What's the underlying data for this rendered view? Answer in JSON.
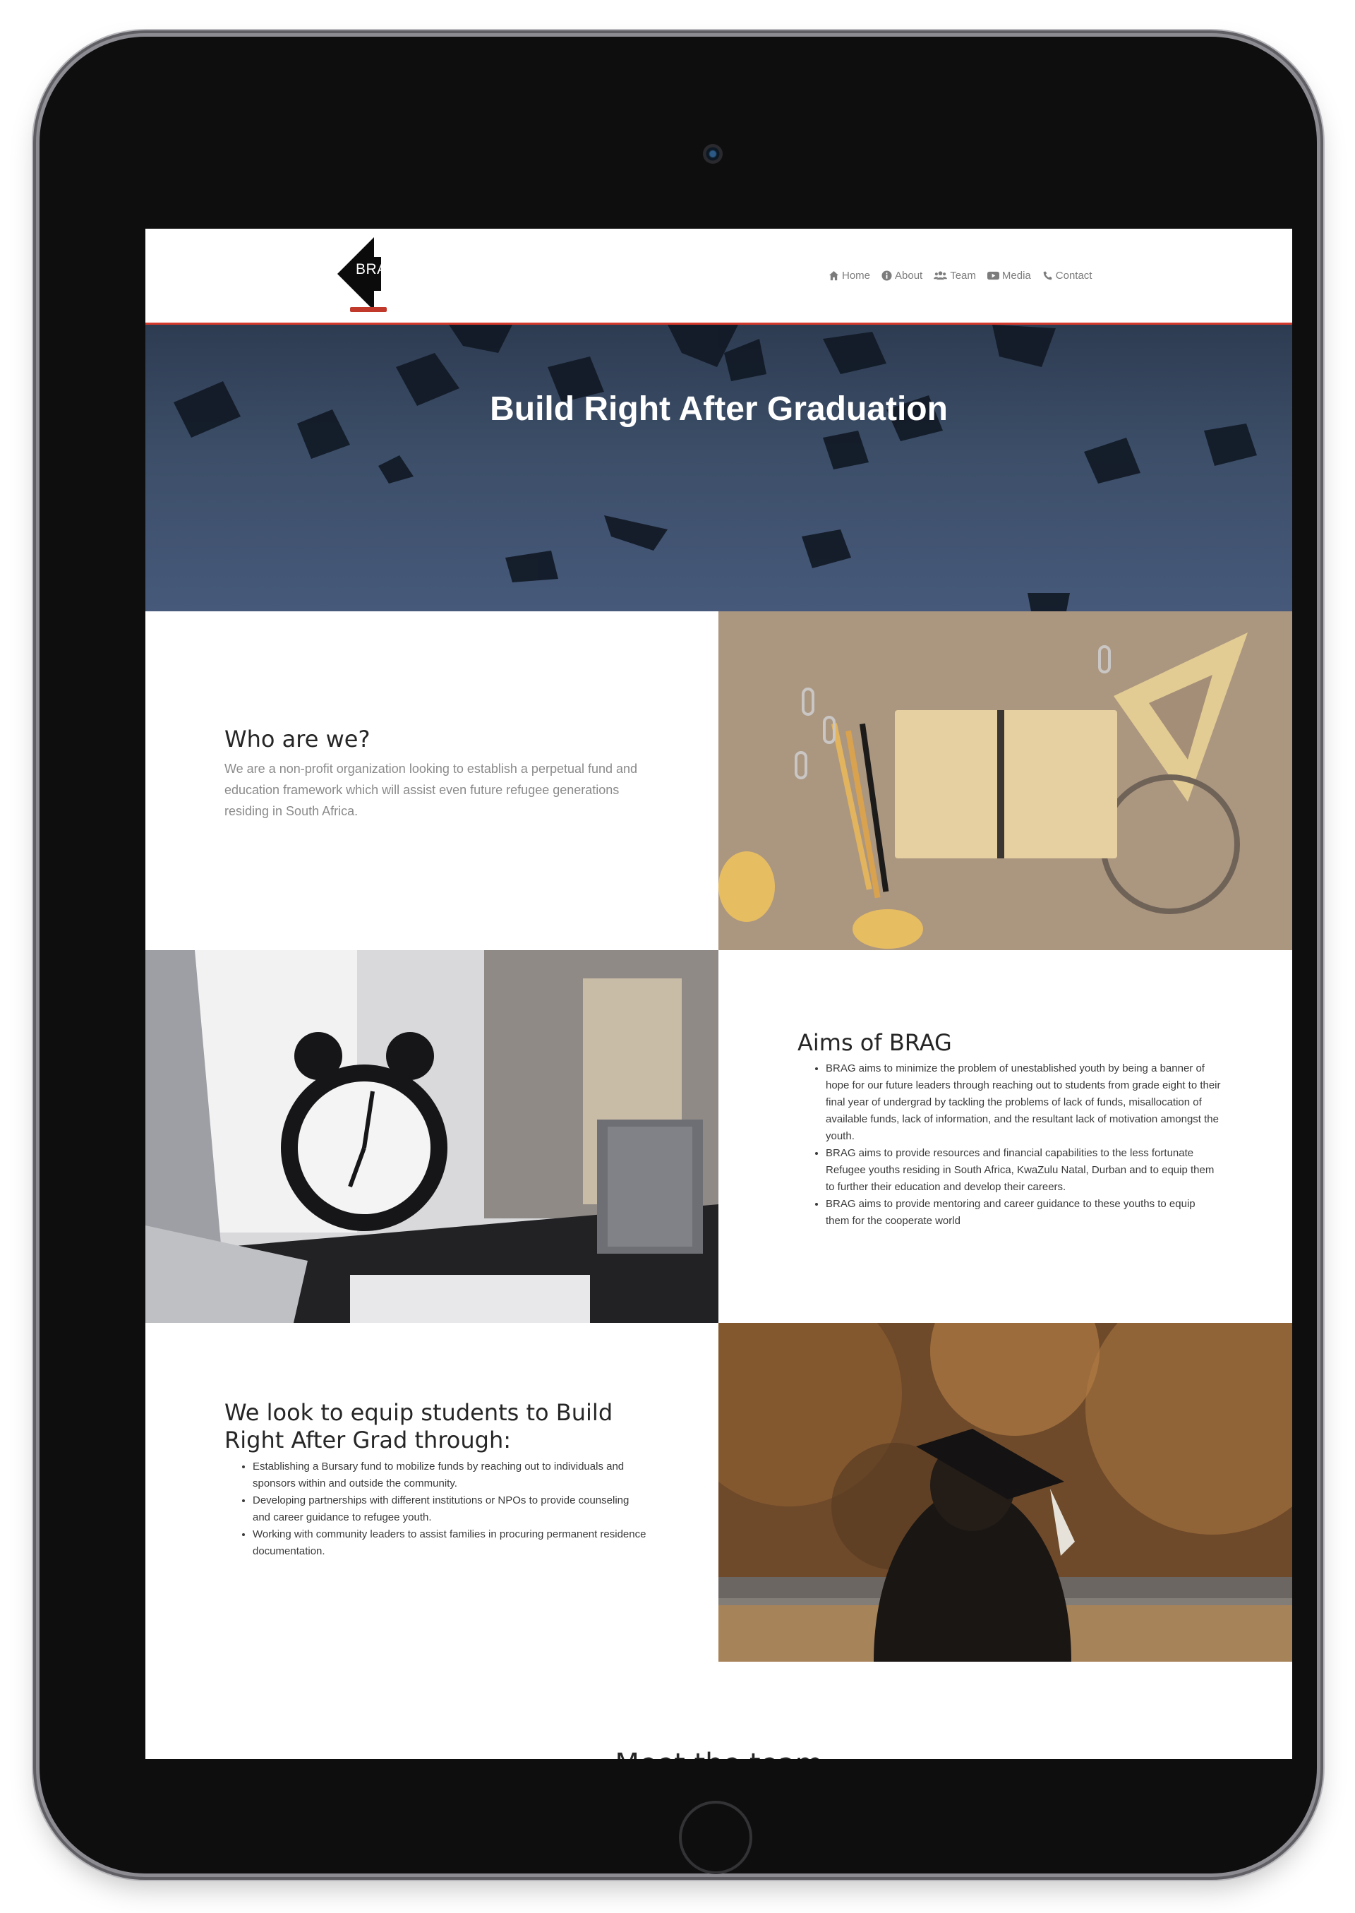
{
  "nav": {
    "logo_text": "BRAG",
    "items": [
      {
        "label": "Home",
        "icon": "home-icon"
      },
      {
        "label": "About",
        "icon": "info-icon"
      },
      {
        "label": "Team",
        "icon": "users-icon"
      },
      {
        "label": "Media",
        "icon": "youtube-icon"
      },
      {
        "label": "Contact",
        "icon": "phone-icon"
      }
    ]
  },
  "hero": {
    "title": "Build Right After Graduation"
  },
  "about": {
    "title": "Who are we?",
    "text": "We are a non-profit organization looking to establish a perpetual fund and education framework which will assist even future refugee generations residing in South Africa."
  },
  "aims": {
    "title": "Aims of BRAG",
    "items": [
      "BRAG aims to minimize the problem of unestablished youth by being a banner of hope for our future leaders through reaching out to students from grade eight to their final year of undergrad by tackling the problems of lack of funds, misallocation of available funds, lack of information, and the resultant lack of motivation amongst the youth.",
      "BRAG aims to provide resources and financial capabilities to the less fortunate Refugee youths residing in South Africa, KwaZulu Natal, Durban and to equip them to further their education and develop their careers.",
      "BRAG aims to provide mentoring and career guidance to these youths to equip them for the cooperate world"
    ]
  },
  "equip": {
    "title": "We look to equip students to Build Right After Grad through:",
    "items": [
      "Establishing a Bursary fund to mobilize funds by reaching out to individuals and sponsors within and outside the community.",
      "Developing partnerships with different institutions or NPOs to provide counseling and career guidance to refugee youth.",
      "Working with community leaders to assist families in procuring permanent residence documentation."
    ]
  },
  "team": {
    "title": "Meet the team"
  },
  "colors": {
    "accent": "#d63a2c",
    "hero": "#3c4e68"
  }
}
